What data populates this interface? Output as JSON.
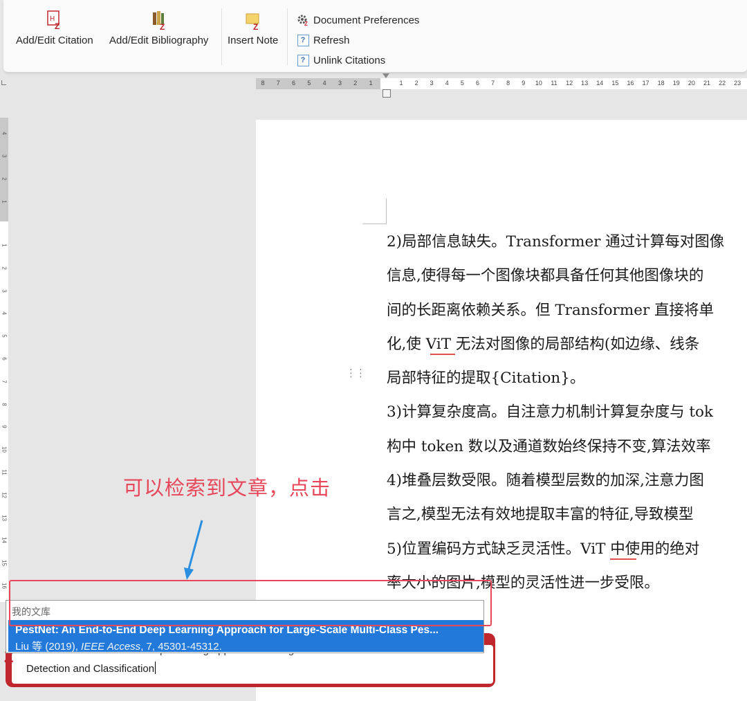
{
  "ribbon": {
    "add_edit_citation": "Add/Edit Citation",
    "add_edit_bibliography": "Add/Edit Bibliography",
    "insert_note": "Insert Note",
    "document_preferences": "Document Preferences",
    "refresh": "Refresh",
    "unlink_citations": "Unlink Citations"
  },
  "ruler": {
    "left_ticks": [
      "8",
      "7",
      "6",
      "5",
      "4",
      "3",
      "2",
      "1"
    ],
    "right_ticks": [
      "1",
      "2",
      "3",
      "4",
      "5",
      "6",
      "7",
      "8",
      "9",
      "10",
      "11",
      "12",
      "13",
      "14",
      "15",
      "16",
      "17",
      "18",
      "19",
      "20",
      "21",
      "22",
      "23"
    ],
    "vertical_ticks_top": [
      "4",
      "3",
      "2",
      "1"
    ],
    "vertical_ticks": [
      "1",
      "2",
      "3",
      "4",
      "5",
      "6",
      "7",
      "8",
      "9",
      "10",
      "11",
      "12",
      "13",
      "14",
      "15",
      "16"
    ]
  },
  "document": {
    "lines": [
      "2)局部信息缺失。Transformer 通过计算每对图像",
      "信息,使得每一个图像块都具备任何其他图像块的",
      "间的长距离依赖关系。但 Transformer 直接将单",
      "化,使 ViT 无法对图像的局部结构(如边缘、线条",
      "局部特征的提取{Citation}。",
      "3)计算复杂度高。自注意力机制计算复杂度与 tok",
      "构中 token 数以及通道数始终保持不变,算法效率",
      "4)堆叠层数受限。随着模型层数的加深,注意力图",
      "言之,模型无法有效地提取丰富的特征,导致模型",
      "5)位置编码方式缺乏灵活性。ViT 中使用的绝对",
      "率大小的图片,模型的灵活性进一步受限。"
    ]
  },
  "annotation": {
    "text": "可以检索到文章，点击"
  },
  "quick_format": {
    "section_header": "我的文库",
    "selected_title": "PestNet: An End-to-End Deep Learning Approach for Large-Scale Multi-Class Pes...",
    "selected_meta_prefix": "Liu 等 (2019), ",
    "selected_meta_journal": "IEEE Access",
    "selected_meta_suffix": ", 7, 45301-45312.",
    "ghost_text": "PestNet: An End-to-End Deep Learning Approach for Large-Scale Multi-Class Pest",
    "input_text": "Detection and Classification",
    "logo": "Z"
  },
  "colors": {
    "zotero_red": "#c0272d",
    "selection_blue": "#2379d9",
    "annotation_red": "#e8475a"
  }
}
